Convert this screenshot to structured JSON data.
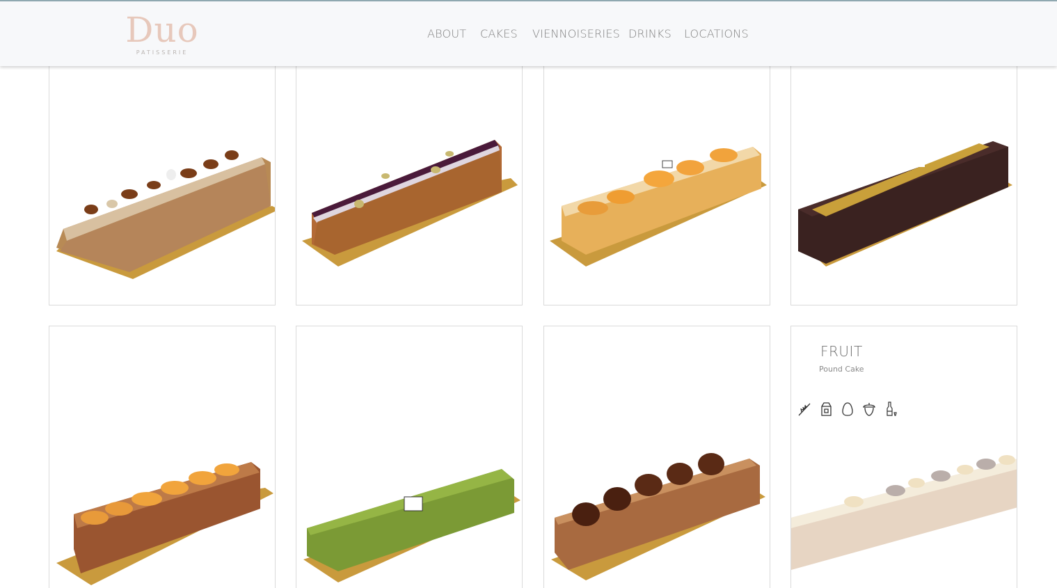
{
  "brand": {
    "name": "Duo",
    "tagline": "PATISSERIE"
  },
  "nav": {
    "items": [
      {
        "label": "ABOUT"
      },
      {
        "label": "CAKES"
      },
      {
        "label": "VIENNOISERIES"
      },
      {
        "label": "DRINKS"
      },
      {
        "label": "LOCATIONS"
      }
    ]
  },
  "products": [
    {
      "cake": "pecan-pound-cake"
    },
    {
      "cake": "blackcurrant-pistachio-pound-cake"
    },
    {
      "cake": "orange-pound-cake"
    },
    {
      "cake": "chocolate-gold-pound-cake"
    },
    {
      "cake": "apricot-pound-cake"
    },
    {
      "cake": "pistachio-pound-cake"
    },
    {
      "cake": "chestnut-pound-cake"
    },
    {
      "name": "FRUIT",
      "category": "Pound Cake",
      "allergen_icons": [
        "wheat-icon",
        "milk-carton-icon",
        "egg-icon",
        "nut-icon",
        "alcohol-bottle-icon"
      ]
    }
  ],
  "colors": {
    "header_bg": "#f7f8fa",
    "logo": "#e7c8bb",
    "nav_text": "#808080",
    "card_border": "#dadada"
  }
}
